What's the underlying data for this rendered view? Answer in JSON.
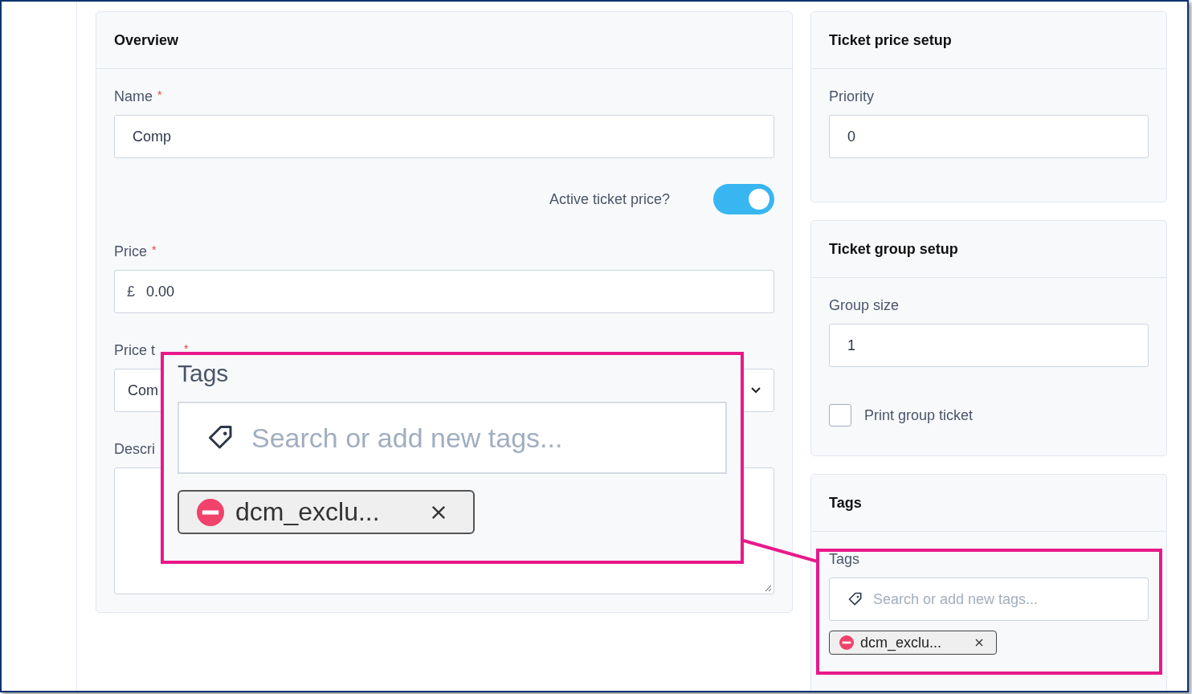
{
  "overview": {
    "title": "Overview",
    "name": {
      "label": "Name",
      "required_mark": "*",
      "value": "Comp"
    },
    "active": {
      "label": "Active ticket price?",
      "on": true
    },
    "price": {
      "label": "Price",
      "required_mark": "*",
      "currency": "£",
      "value": "0.00"
    },
    "price_type": {
      "label": "Price t",
      "required_mark": "*",
      "value": "Com"
    },
    "description": {
      "label": "Descri"
    }
  },
  "ticket_price_setup": {
    "title": "Ticket price setup",
    "priority": {
      "label": "Priority",
      "value": "0"
    }
  },
  "ticket_group_setup": {
    "title": "Ticket group setup",
    "group_size": {
      "label": "Group size",
      "value": "1"
    },
    "print_group_ticket": {
      "label": "Print group ticket",
      "checked": false
    }
  },
  "tags": {
    "title": "Tags",
    "label": "Tags",
    "placeholder": "Search or add new tags...",
    "chips": [
      {
        "label": "dcm_exclu..."
      }
    ]
  },
  "callout": {
    "label": "Tags",
    "placeholder": "Search or add new tags...",
    "chips": [
      {
        "label": "dcm_exclu..."
      }
    ]
  }
}
